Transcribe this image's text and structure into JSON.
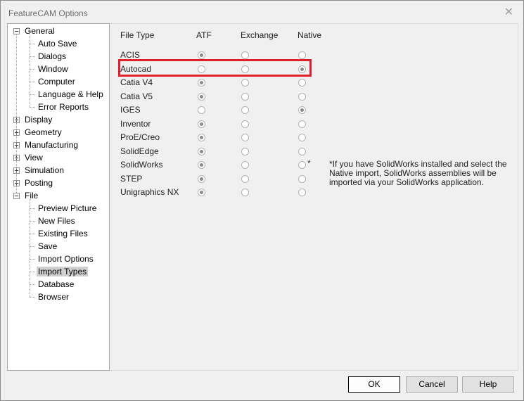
{
  "window": {
    "title": "FeatureCAM Options",
    "close_glyph": "✕"
  },
  "tree": {
    "nodes": [
      {
        "label": "General",
        "kind": "group",
        "expanded": true
      },
      {
        "label": "Auto Save",
        "kind": "child"
      },
      {
        "label": "Dialogs",
        "kind": "child"
      },
      {
        "label": "Window",
        "kind": "child"
      },
      {
        "label": "Computer",
        "kind": "child"
      },
      {
        "label": "Language & Help",
        "kind": "child"
      },
      {
        "label": "Error Reports",
        "kind": "child"
      },
      {
        "label": "Display",
        "kind": "group",
        "expanded": false
      },
      {
        "label": "Geometry",
        "kind": "group",
        "expanded": false
      },
      {
        "label": "Manufacturing",
        "kind": "group",
        "expanded": false
      },
      {
        "label": "View",
        "kind": "group",
        "expanded": false
      },
      {
        "label": "Simulation",
        "kind": "group",
        "expanded": false
      },
      {
        "label": "Posting",
        "kind": "group",
        "expanded": false
      },
      {
        "label": "File",
        "kind": "group",
        "expanded": true
      },
      {
        "label": "Preview Picture",
        "kind": "child"
      },
      {
        "label": "New Files",
        "kind": "child"
      },
      {
        "label": "Existing Files",
        "kind": "child"
      },
      {
        "label": "Save",
        "kind": "child"
      },
      {
        "label": "Import Options",
        "kind": "child"
      },
      {
        "label": "Import Types",
        "kind": "child",
        "selected": true
      },
      {
        "label": "Database",
        "kind": "child"
      },
      {
        "label": "Browser",
        "kind": "child"
      }
    ]
  },
  "import_types": {
    "headers": [
      "File Type",
      "ATF",
      "Exchange",
      "Native"
    ],
    "rows": [
      {
        "type": "ACIS",
        "selected": "ATF"
      },
      {
        "type": "Autocad",
        "selected": "Native"
      },
      {
        "type": "Catia V4",
        "selected": "ATF"
      },
      {
        "type": "Catia V5",
        "selected": "ATF"
      },
      {
        "type": "IGES",
        "selected": "Native"
      },
      {
        "type": "Inventor",
        "selected": "ATF"
      },
      {
        "type": "ProE/Creo",
        "selected": "ATF"
      },
      {
        "type": "SolidEdge",
        "selected": "ATF"
      },
      {
        "type": "SolidWorks",
        "selected": "ATF",
        "native_mark": "*"
      },
      {
        "type": "STEP",
        "selected": "ATF"
      },
      {
        "type": "Unigraphics NX",
        "selected": "ATF"
      }
    ],
    "note": "*If you have SolidWorks installed and select the Native import, SolidWorks assemblies will be imported via your SolidWorks application."
  },
  "buttons": {
    "ok": "OK",
    "cancel": "Cancel",
    "help": "Help"
  },
  "colors": {
    "highlight": "#e0202a",
    "selection": "#cfcfcf"
  }
}
